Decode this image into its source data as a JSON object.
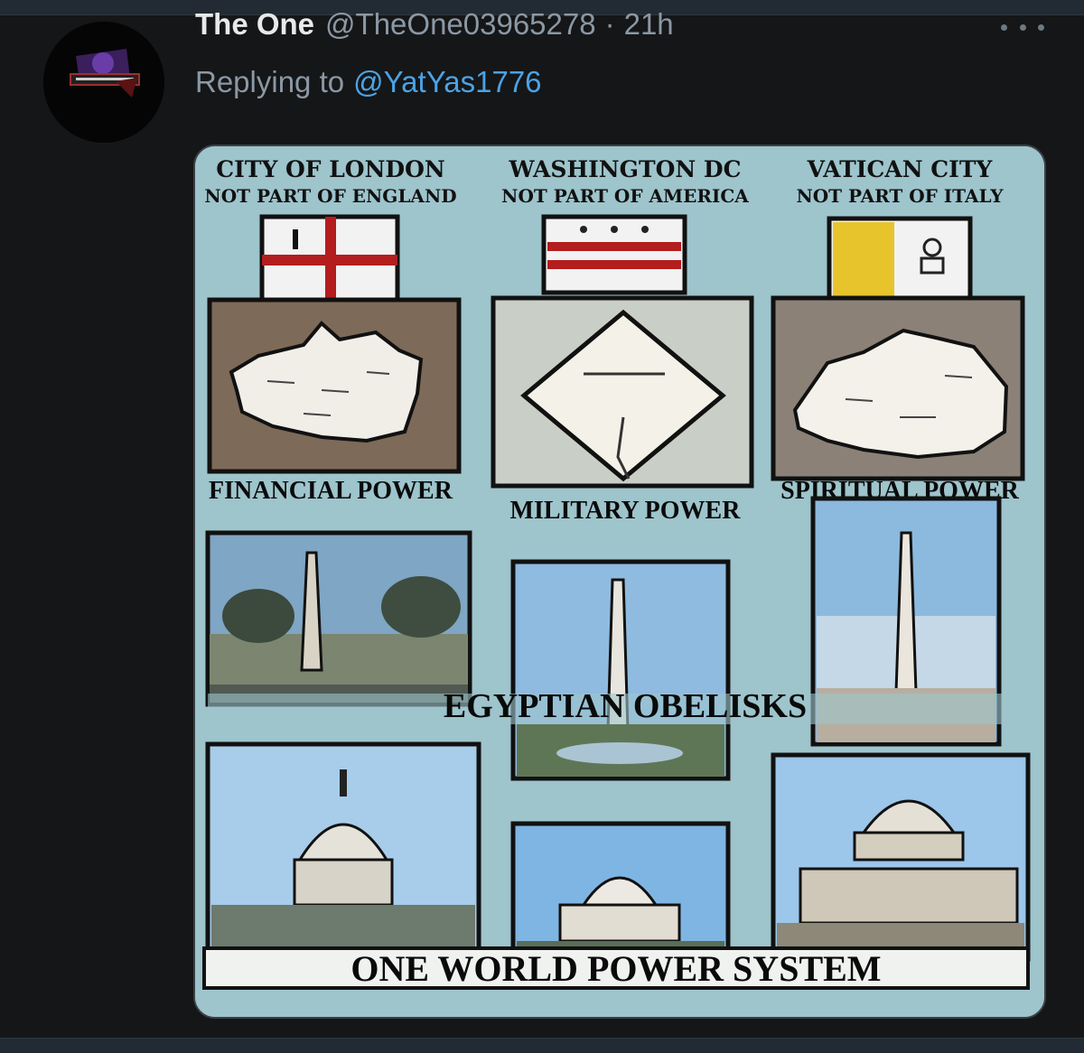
{
  "tweet": {
    "author_name": "The One",
    "author_handle": "@TheOne03965278",
    "separator": "·",
    "time": "21h",
    "reply_prefix": "Replying to",
    "reply_to": "@YatYas1776"
  },
  "image": {
    "columns": [
      {
        "place": "CITY OF LONDON",
        "note": "NOT PART OF ENGLAND",
        "power": "FINANCIAL POWER"
      },
      {
        "place": "WASHINGTON DC",
        "note": "NOT PART OF AMERICA",
        "power": "MILITARY POWER"
      },
      {
        "place": "VATICAN CITY",
        "note": "NOT PART OF ITALY",
        "power": "SPIRITUAL POWER"
      }
    ],
    "middle_banner": "EGYPTIAN OBELISKS",
    "bottom_banner": "ONE WORLD POWER SYSTEM"
  },
  "colors": {
    "background": "#151617",
    "name": "#e7e9ea",
    "muted": "#8b98a5",
    "link": "#4ba3e6",
    "poster_bg": "#9ec4cc"
  },
  "icons": {
    "more": "more-horizontal-icon"
  }
}
